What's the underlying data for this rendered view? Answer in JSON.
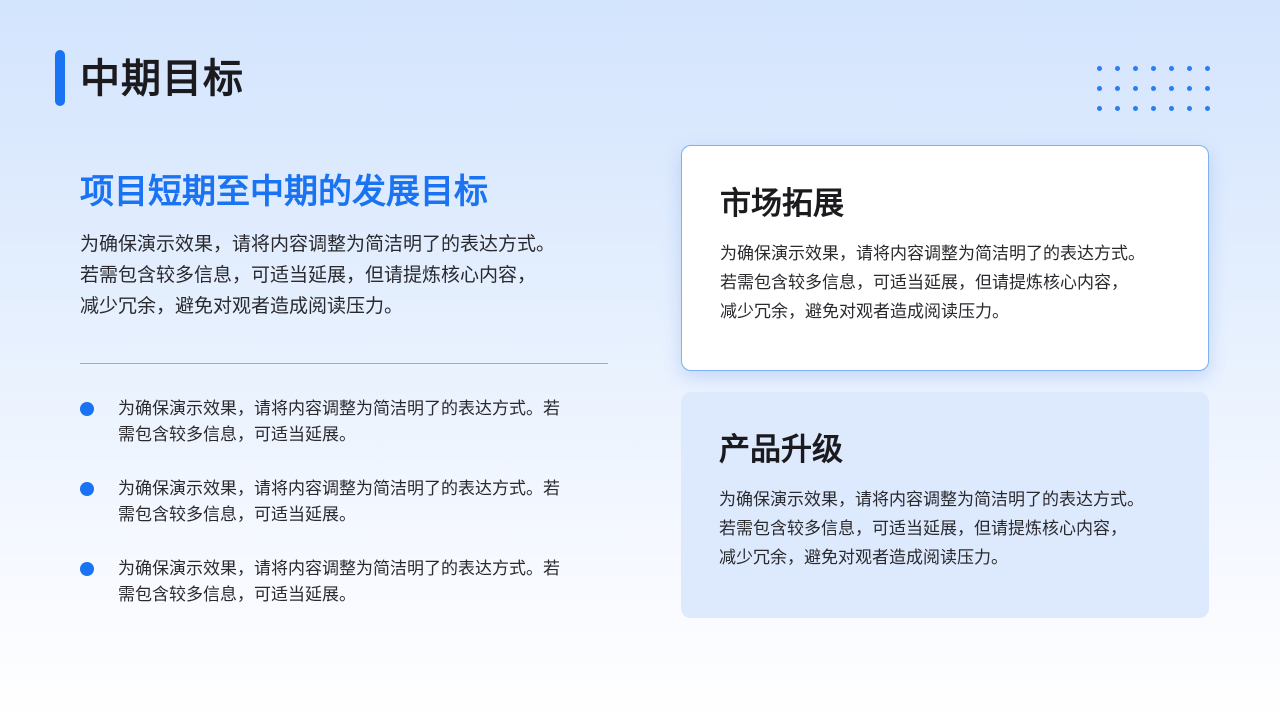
{
  "header": {
    "title": "中期目标"
  },
  "decor": {
    "accent_color": "#1a73f2",
    "dot_grid_icon": "dot-grid-decoration"
  },
  "main": {
    "subtitle": "项目短期至中期的发展目标",
    "intro_lines": [
      "为确保演示效果，请将内容调整为简洁明了的表达方式。",
      "若需包含较多信息，可适当延展，但请提炼核心内容，",
      "减少冗余，避免对观者造成阅读压力。"
    ],
    "bullets": [
      {
        "line1": "为确保演示效果，请将内容调整为简洁明了的表达方式。若",
        "line2": "需包含较多信息，可适当延展。"
      },
      {
        "line1": "为确保演示效果，请将内容调整为简洁明了的表达方式。若",
        "line2": "需包含较多信息，可适当延展。"
      },
      {
        "line1": "为确保演示效果，请将内容调整为简洁明了的表达方式。若",
        "line2": "需包含较多信息，可适当延展。"
      }
    ]
  },
  "cards": [
    {
      "title": "市场拓展",
      "lines": [
        "为确保演示效果，请将内容调整为简洁明了的表达方式。",
        "若需包含较多信息，可适当延展，但请提炼核心内容，",
        "减少冗余，避免对观者造成阅读压力。"
      ]
    },
    {
      "title": "产品升级",
      "lines": [
        "为确保演示效果，请将内容调整为简洁明了的表达方式。",
        "若需包含较多信息，可适当延展，但请提炼核心内容，",
        "减少冗余，避免对观者造成阅读压力。"
      ]
    }
  ]
}
